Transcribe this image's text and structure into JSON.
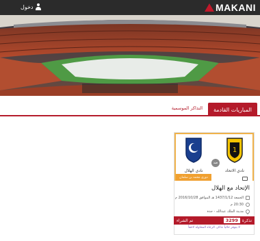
{
  "header": {
    "brand": "MAKANI",
    "login_label": "دخول"
  },
  "tabs": {
    "active": "المباريات القادمة",
    "other": "التذاكر الموسمية"
  },
  "match": {
    "home_team": "نادي الاتحاد",
    "away_team": "نادي الهلال",
    "home_logo_text": "ITTIHAD CLUB",
    "away_logo_text": "ALHILAL FC",
    "vs": "ضد",
    "league": "دوري محمد بن سلمان",
    "title": "الإتحاد مع الهلال",
    "date_line": "الجمعة 1437/1/12 هـ الموافق 2016/10/28 م",
    "time_line": "20:30 م",
    "venue_line": "مدينة الملك عبدالله - جدة",
    "price_label": "تذكرة",
    "price": "3299",
    "buy_label": "تم الشراء",
    "footnote": "لا يتوفر حالياً تذاكر، الرجاء المحاولة لاحقاً"
  },
  "colors": {
    "header_bg": "#2b2b2b",
    "accent": "#b41a2a",
    "league_badge": "#f0a030",
    "card_border": "#f0b24a"
  },
  "icons": [
    "user-icon",
    "tv-icon",
    "calendar-icon",
    "clock-icon",
    "location-icon"
  ]
}
